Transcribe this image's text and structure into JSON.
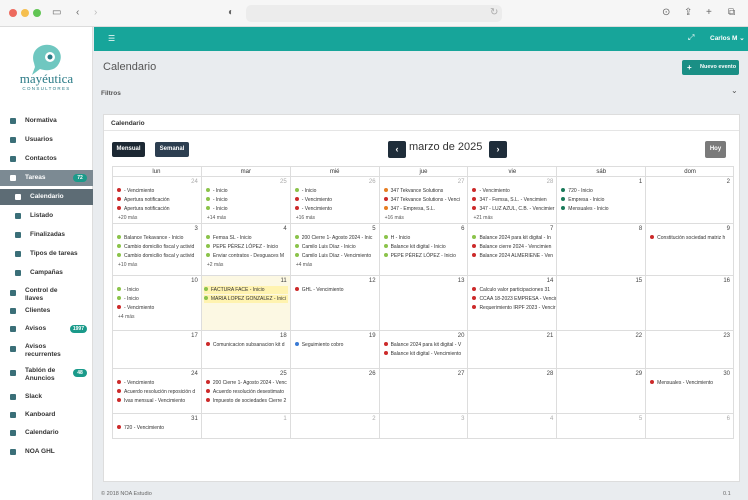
{
  "browser": {
    "icons": [
      "sidebar-toggle-icon",
      "back-icon",
      "forward-icon",
      "privacy-icon",
      "reload-icon",
      "download-icon",
      "share-icon",
      "new-tab-icon",
      "tabs-overview-icon"
    ]
  },
  "brand": {
    "name": "mayéutica",
    "sub": "CONSULTORES"
  },
  "sidebar": {
    "items": [
      {
        "label": "Normativa",
        "icon": "book-icon",
        "sub": false,
        "state": "",
        "badge": ""
      },
      {
        "label": "Usuarios",
        "icon": "users-icon",
        "sub": false,
        "state": "",
        "badge": ""
      },
      {
        "label": "Contactos",
        "icon": "contacts-icon",
        "sub": false,
        "state": "",
        "badge": ""
      },
      {
        "label": "Tareas",
        "icon": "tasks-icon",
        "sub": false,
        "state": "active",
        "badge": "72"
      },
      {
        "label": "Calendario",
        "icon": "calendar-icon",
        "sub": true,
        "state": "subactive",
        "badge": ""
      },
      {
        "label": "Listado",
        "icon": "list-icon",
        "sub": true,
        "state": "",
        "badge": ""
      },
      {
        "label": "Finalizadas",
        "icon": "check-icon",
        "sub": true,
        "state": "",
        "badge": ""
      },
      {
        "label": "Tipos de tareas",
        "icon": "types-icon",
        "sub": true,
        "state": "",
        "badge": ""
      },
      {
        "label": "Campañas",
        "icon": "campaign-icon",
        "sub": true,
        "state": "",
        "badge": ""
      },
      {
        "label": "Control de llaves",
        "icon": "key-icon",
        "sub": false,
        "state": "",
        "badge": ""
      },
      {
        "label": "Clientes",
        "icon": "clients-icon",
        "sub": false,
        "state": "",
        "badge": ""
      },
      {
        "label": "Avisos",
        "icon": "bell-icon",
        "sub": false,
        "state": "",
        "badge": "1997"
      },
      {
        "label": "Avisos recurrentes",
        "icon": "repeat-icon",
        "sub": false,
        "state": "",
        "badge": ""
      },
      {
        "label": "Tablón de Anuncios",
        "icon": "board-icon",
        "sub": false,
        "state": "",
        "badge": "48"
      },
      {
        "label": "Slack",
        "icon": "slack-icon",
        "sub": false,
        "state": "",
        "badge": ""
      },
      {
        "label": "Kanboard",
        "icon": "kanban-icon",
        "sub": false,
        "state": "",
        "badge": ""
      },
      {
        "label": "Calendario",
        "icon": "calendar-icon",
        "sub": false,
        "state": "",
        "badge": ""
      },
      {
        "label": "NOA GHL",
        "icon": "globe-icon",
        "sub": false,
        "state": "",
        "badge": ""
      }
    ]
  },
  "topbar": {
    "user": "Carlos M ⌄"
  },
  "page": {
    "title": "Calendario",
    "new_event": "Nuevo evento",
    "filters": "Filtros"
  },
  "calendar": {
    "card_title": "Calendario",
    "view_month": "Mensual",
    "view_week": "Semanal",
    "month_label": "marzo de 2025",
    "today_btn": "Hoy",
    "days_of_week": [
      "lun",
      "mar",
      "mié",
      "jue",
      "vie",
      "sáb",
      "dom"
    ],
    "weeks": [
      [
        {
          "day": "24",
          "other": true,
          "events": [
            {
              "t": "- Vencimiento",
              "c": "#cc2a2a"
            },
            {
              "t": "Apertura notificación",
              "c": "#cc2a2a"
            },
            {
              "t": "Apertura notificación",
              "c": "#cc2a2a"
            }
          ],
          "more": "+20 más"
        },
        {
          "day": "25",
          "other": true,
          "events": [
            {
              "t": "- Inicio",
              "c": "#8bc34a"
            },
            {
              "t": "- Inicio",
              "c": "#8bc34a"
            },
            {
              "t": "- Inicio",
              "c": "#8bc34a"
            }
          ],
          "more": "+14 más"
        },
        {
          "day": "26",
          "other": true,
          "events": [
            {
              "t": "- Inicio",
              "c": "#8bc34a"
            },
            {
              "t": "- Vencimiento",
              "c": "#cc2a2a"
            },
            {
              "t": "- Vencimiento",
              "c": "#cc2a2a"
            }
          ],
          "more": "+16 más"
        },
        {
          "day": "27",
          "other": true,
          "events": [
            {
              "t": "347 Tekvance Solutions",
              "c": "#e67e22"
            },
            {
              "t": "347 Tekvance Solutions - Venci",
              "c": "#cc2a2a"
            },
            {
              "t": "347 - Empresa, S.L.",
              "c": "#e67e22"
            }
          ],
          "more": "+16 más"
        },
        {
          "day": "28",
          "other": true,
          "events": [
            {
              "t": "- Vencimiento",
              "c": "#cc2a2a"
            },
            {
              "t": "347 - Femsa, S.L. - Vencimien",
              "c": "#cc2a2a"
            },
            {
              "t": "347 - LUZ AZUL, C.B. - Vencimier",
              "c": "#cc2a2a"
            }
          ],
          "more": "+21 más"
        },
        {
          "day": "1",
          "other": false,
          "events": [
            {
              "t": "720 - Inicio",
              "c": "#1a7a5a"
            },
            {
              "t": "Empresa - Inicio",
              "c": "#1a7a5a"
            },
            {
              "t": "Mensuales - Inicio",
              "c": "#1a7a5a"
            }
          ],
          "more": ""
        },
        {
          "day": "2",
          "other": false,
          "events": [],
          "more": ""
        }
      ],
      [
        {
          "day": "3",
          "other": false,
          "events": [
            {
              "t": "Balance Tekavance - Inicio",
              "c": "#8bc34a"
            },
            {
              "t": "Cambio domicilio fiscal y activid",
              "c": "#8bc34a"
            },
            {
              "t": "Cambio domicilio fiscal y activid",
              "c": "#8bc34a"
            }
          ],
          "more": "+10 más"
        },
        {
          "day": "4",
          "other": false,
          "events": [
            {
              "t": "Femsa SL - Inicio",
              "c": "#8bc34a"
            },
            {
              "t": "PEPE PÉREZ LÓPEZ - Inicio",
              "c": "#8bc34a"
            },
            {
              "t": "Enviar contratos - Desguaces M",
              "c": "#8bc34a"
            }
          ],
          "more": "+2 más"
        },
        {
          "day": "5",
          "other": false,
          "events": [
            {
              "t": "200 Cierre 1- Agosto 2024 - Inic",
              "c": "#8bc34a"
            },
            {
              "t": "Camilo Luis Díaz - Inicio",
              "c": "#8bc34a"
            },
            {
              "t": "Camilo Luis Díaz - Vencimiento",
              "c": "#8bc34a"
            }
          ],
          "more": "+4 más"
        },
        {
          "day": "6",
          "other": false,
          "events": [
            {
              "t": "H - Inicio",
              "c": "#8bc34a"
            },
            {
              "t": "Balance kit digital - Inicio",
              "c": "#8bc34a"
            },
            {
              "t": "PEPE PÉREZ LÓPEZ - Inicio",
              "c": "#8bc34a"
            }
          ],
          "more": ""
        },
        {
          "day": "7",
          "other": false,
          "events": [
            {
              "t": "Balance 2024 para kit digital - In",
              "c": "#8bc34a"
            },
            {
              "t": "Balance cierre 2024 - Vencimien",
              "c": "#cc2a2a"
            },
            {
              "t": "Balance 2024 ALMERIENE - Ven",
              "c": "#cc2a2a"
            }
          ],
          "more": ""
        },
        {
          "day": "8",
          "other": false,
          "events": [],
          "more": ""
        },
        {
          "day": "9",
          "other": false,
          "events": [
            {
              "t": "Constitución sociedad matriz h",
              "c": "#cc2a2a"
            }
          ],
          "more": ""
        }
      ],
      [
        {
          "day": "10",
          "other": false,
          "events": [
            {
              "t": "- Inicio",
              "c": "#8bc34a"
            },
            {
              "t": "- Inicio",
              "c": "#8bc34a"
            },
            {
              "t": "- Vencimiento",
              "c": "#cc2a2a"
            }
          ],
          "more": "+4 más"
        },
        {
          "day": "11",
          "other": false,
          "today": true,
          "events": [
            {
              "t": "FACTURA FACE - Inicio",
              "c": "#8bc34a",
              "bar": true
            },
            {
              "t": "MARIA LOPEZ GONZALEZ - Inici",
              "c": "#8bc34a",
              "bar": true
            }
          ],
          "more": ""
        },
        {
          "day": "12",
          "other": false,
          "events": [
            {
              "t": "GHL - Vencimiento",
              "c": "#cc2a2a"
            }
          ],
          "more": ""
        },
        {
          "day": "13",
          "other": false,
          "events": [],
          "more": ""
        },
        {
          "day": "14",
          "other": false,
          "events": [
            {
              "t": "Calculo valor participaciones 31",
              "c": "#cc2a2a"
            },
            {
              "t": "CCAA 18-2023 EMPRESA - Vencim",
              "c": "#cc2a2a"
            },
            {
              "t": "Requerimiento IRPF 2023 - Vencir",
              "c": "#cc2a2a"
            }
          ],
          "more": ""
        },
        {
          "day": "15",
          "other": false,
          "events": [],
          "more": ""
        },
        {
          "day": "16",
          "other": false,
          "events": [],
          "more": ""
        }
      ],
      [
        {
          "day": "17",
          "other": false,
          "events": [],
          "more": ""
        },
        {
          "day": "18",
          "other": false,
          "events": [
            {
              "t": "Comunicacion subsanacion kit d",
              "c": "#cc2a2a"
            }
          ],
          "more": ""
        },
        {
          "day": "19",
          "other": false,
          "events": [
            {
              "t": "Seguimiento cobro",
              "c": "#3a7bd5"
            }
          ],
          "more": ""
        },
        {
          "day": "20",
          "other": false,
          "events": [
            {
              "t": "Balance 2024 para kit digital - V",
              "c": "#cc2a2a"
            },
            {
              "t": "Balance kit digital - Vencimiento",
              "c": "#cc2a2a"
            }
          ],
          "more": ""
        },
        {
          "day": "21",
          "other": false,
          "events": [],
          "more": ""
        },
        {
          "day": "22",
          "other": false,
          "events": [],
          "more": ""
        },
        {
          "day": "23",
          "other": false,
          "events": [],
          "more": ""
        }
      ],
      [
        {
          "day": "24",
          "other": false,
          "events": [
            {
              "t": "- Vencimiento",
              "c": "#cc2a2a"
            },
            {
              "t": "Acuerdo resolución reposición d",
              "c": "#cc2a2a"
            },
            {
              "t": "Ivas mensual - Vencimiento",
              "c": "#cc2a2a"
            }
          ],
          "more": ""
        },
        {
          "day": "25",
          "other": false,
          "events": [
            {
              "t": "200 Cierre 1- Agosto 2024 - Venc",
              "c": "#cc2a2a"
            },
            {
              "t": "Acuerdo resolución desestimato",
              "c": "#cc2a2a"
            },
            {
              "t": "Impuesto de sociedades Cierre 2",
              "c": "#cc2a2a"
            }
          ],
          "more": ""
        },
        {
          "day": "26",
          "other": false,
          "events": [],
          "more": ""
        },
        {
          "day": "27",
          "other": false,
          "events": [],
          "more": ""
        },
        {
          "day": "28",
          "other": false,
          "events": [],
          "more": ""
        },
        {
          "day": "29",
          "other": false,
          "events": [],
          "more": ""
        },
        {
          "day": "30",
          "other": false,
          "events": [
            {
              "t": "Mensuales - Vencimiento",
              "c": "#cc2a2a"
            }
          ],
          "more": ""
        }
      ],
      [
        {
          "day": "31",
          "other": false,
          "events": [
            {
              "t": "720 - Vencimiento",
              "c": "#cc2a2a"
            }
          ],
          "more": ""
        },
        {
          "day": "1",
          "other": true,
          "events": [],
          "more": ""
        },
        {
          "day": "2",
          "other": true,
          "events": [],
          "more": ""
        },
        {
          "day": "3",
          "other": true,
          "events": [],
          "more": ""
        },
        {
          "day": "4",
          "other": true,
          "events": [],
          "more": ""
        },
        {
          "day": "5",
          "other": true,
          "events": [],
          "more": ""
        },
        {
          "day": "6",
          "other": true,
          "events": [],
          "more": ""
        }
      ]
    ]
  },
  "footer": {
    "copyright": "© 2018 NOA Estudio",
    "version": "0.1"
  }
}
